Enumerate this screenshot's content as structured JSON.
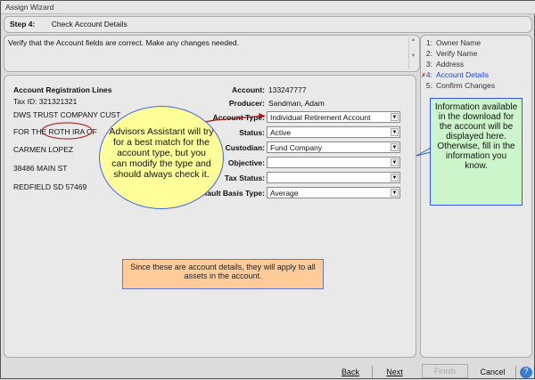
{
  "window": {
    "title": "Assign Wizard"
  },
  "step": {
    "number": "Step 4:",
    "title": "Check Account Details"
  },
  "description": "Verify that the Account fields are correct.  Make any changes needed.",
  "registration": {
    "heading": "Account Registration Lines",
    "tax_id": "Tax ID: 321321321",
    "lines": [
      "DWS TRUST COMPANY CUST",
      "FOR THE ROTH IRA OF",
      "CARMEN LOPEZ",
      "38486 MAIN ST",
      "REDFIELD SD  57469"
    ]
  },
  "fields": {
    "account": {
      "label": "Account:",
      "value": "133247777"
    },
    "producer": {
      "label": "Producer:",
      "value": "Sandman, Adam"
    },
    "account_type": {
      "label": "Account Type:",
      "value": "Individual Retirement Account"
    },
    "status": {
      "label": "Status:",
      "value": "Active"
    },
    "custodian": {
      "label": "Custodian:",
      "value": "Fund Company"
    },
    "objective": {
      "label": "Objective:",
      "value": ""
    },
    "tax_status": {
      "label": "Tax Status:",
      "value": ""
    },
    "basis_type": {
      "label": "Default Basis Type:",
      "value": "Average"
    }
  },
  "steps": [
    {
      "n": "1:",
      "label": "Owner Name"
    },
    {
      "n": "2:",
      "label": "Verify Name"
    },
    {
      "n": "3:",
      "label": "Address"
    },
    {
      "n": "4:",
      "label": "Account Details",
      "active": true
    },
    {
      "n": "5:",
      "label": "Confirm Changes"
    }
  ],
  "callouts": {
    "yellow": "Advisors Assistant will try for a best match for the account type, but you can modify the type and should always check it.",
    "green": "Information available in the download for the account will be displayed here. Otherwise, fill in the information you know.",
    "orange": "Since these are account details, they will apply to all assets in the account."
  },
  "buttons": {
    "back": "Back",
    "next": "Next",
    "finish": "Finish",
    "cancel": "Cancel"
  },
  "colors": {
    "active_step": "#2244cc",
    "yellow_callout": "#ffff99",
    "green_callout": "#ccf5cc",
    "orange_callout": "#ffcc99",
    "annotation_red": "#aa1111"
  }
}
